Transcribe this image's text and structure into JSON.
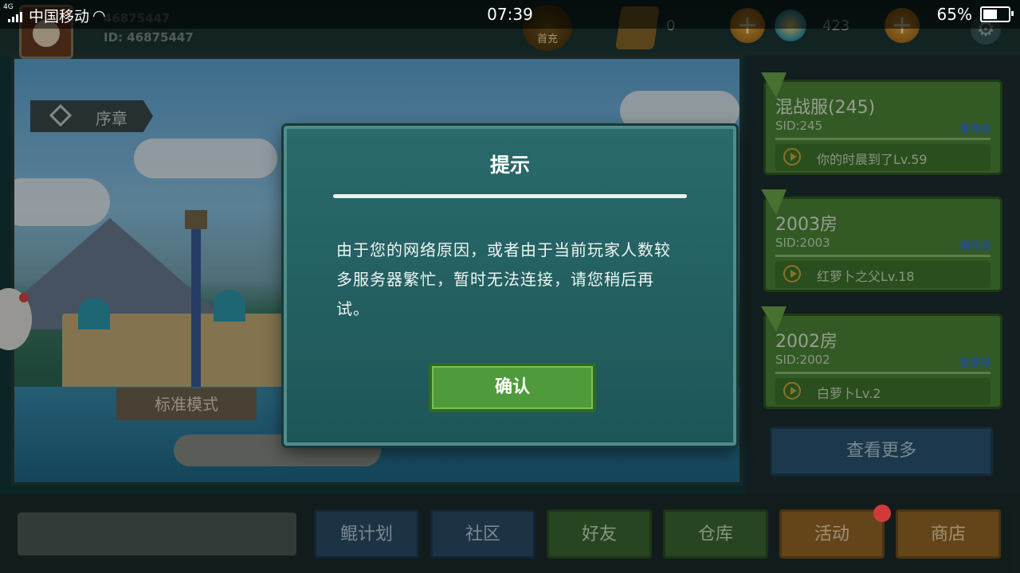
{
  "status_bar": {
    "network_type": "4G",
    "carrier": "中国移动",
    "time": "07:39",
    "battery_percent": "65%",
    "battery_level": 0.65
  },
  "hud": {
    "player_name_faded": "46875447",
    "player_id": "ID: 46875447",
    "first_recharge": "首充",
    "gem_count": "0",
    "sun_count": "423",
    "plus_symbol": "+",
    "gear_symbol": "⚙"
  },
  "map": {
    "chapter_label": "序章",
    "mode_label": "标准模式"
  },
  "servers": [
    {
      "name": "混战服(245)",
      "sid": "SID:245",
      "tag": "推荐服",
      "role": "你的时晨到了Lv.59"
    },
    {
      "name": "2003房",
      "sid": "SID:2003",
      "tag": "推荐服",
      "role": "红萝卜之父Lv.18"
    },
    {
      "name": "2002房",
      "sid": "SID:2002",
      "tag": "推荐服",
      "role": "白萝卜Lv.2"
    }
  ],
  "more_button": "查看更多",
  "bottom_nav": [
    {
      "label": "鲲计划"
    },
    {
      "label": "社区"
    },
    {
      "label": "好友"
    },
    {
      "label": "仓库"
    },
    {
      "label": "活动"
    },
    {
      "label": "商店"
    }
  ],
  "dialog": {
    "title": "提示",
    "message": "由于您的网络原因，或者由于当前玩家人数较多服务器繁忙，暂时无法连接，请您稍后再试。",
    "confirm": "确认"
  },
  "colors": {
    "dialog_bg": "#1e5658",
    "confirm_green": "#4f9a3a",
    "server_green": "#4f8a3a",
    "nav_blue": "#2b4f6c",
    "nav_orange": "#9a6a27",
    "notification_red": "#d23a3a"
  }
}
